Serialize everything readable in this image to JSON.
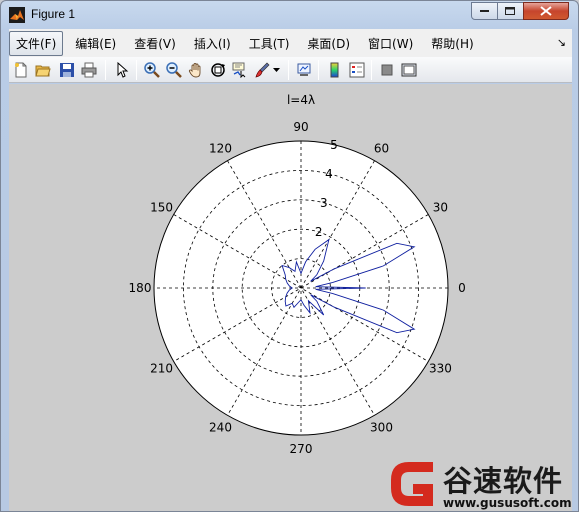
{
  "window": {
    "title": "Figure 1"
  },
  "menu": {
    "items": [
      {
        "label": "文件(F)"
      },
      {
        "label": "编辑(E)"
      },
      {
        "label": "查看(V)"
      },
      {
        "label": "插入(I)"
      },
      {
        "label": "工具(T)"
      },
      {
        "label": "桌面(D)"
      },
      {
        "label": "窗口(W)"
      },
      {
        "label": "帮助(H)"
      }
    ],
    "dock_glyph": "↘"
  },
  "toolbar": {
    "icons": [
      "new-figure-icon",
      "open-file-icon",
      "save-icon",
      "print-icon",
      "edit-plot-arrow-icon",
      "zoom-in-icon",
      "zoom-out-icon",
      "pan-hand-icon",
      "rotate-3d-icon",
      "data-cursor-icon",
      "brush-icon",
      "brush-dropdown-icon",
      "link-plot-icon",
      "colorbar-icon",
      "legend-icon",
      "hide-plot-tools-icon",
      "show-plot-tools-icon"
    ]
  },
  "colors": {
    "accent_line": "#1020a0",
    "figure_bg": "#cccccc",
    "watermark_red": "#d42a1e"
  },
  "chart_data": {
    "type": "line",
    "subtype": "polar",
    "title": "l=4λ",
    "radial_ticks": [
      "2",
      "3",
      "4",
      "5"
    ],
    "rlim": [
      0,
      5
    ],
    "angle_tick_labels": [
      "0",
      "30",
      "60",
      "90",
      "120",
      "150",
      "180",
      "210",
      "240",
      "270",
      "300",
      "330"
    ],
    "grid": true,
    "series": [
      {
        "theta_deg": [
          -90,
          -80,
          -70,
          -60,
          -50,
          -40,
          -35,
          -30,
          -25,
          -20,
          -15,
          -10,
          -5,
          0,
          5,
          10,
          15,
          20,
          25,
          30,
          35,
          40,
          50,
          60,
          70,
          80,
          90,
          100,
          110,
          120,
          130,
          140,
          150,
          160,
          170,
          180,
          190,
          200,
          210,
          220,
          230,
          240,
          250,
          260,
          270
        ],
        "r": [
          0.4,
          0.6,
          0.9,
          0.5,
          1.2,
          0.7,
          0.4,
          1.3,
          3.6,
          4.1,
          2.9,
          1.1,
          0.5,
          2.2,
          0.5,
          1.1,
          2.9,
          4.1,
          3.6,
          1.3,
          0.4,
          0.7,
          1.2,
          1.9,
          1.4,
          0.9,
          0.5,
          0.9,
          0.6,
          0.8,
          1.0,
          0.7,
          0.6,
          0.5,
          0.4,
          0.3,
          0.4,
          0.5,
          0.6,
          0.7,
          0.8,
          0.6,
          0.7,
          0.5,
          0.4
        ]
      }
    ]
  },
  "watermark": {
    "title": "谷速软件",
    "url": "www.gususoft.com"
  }
}
